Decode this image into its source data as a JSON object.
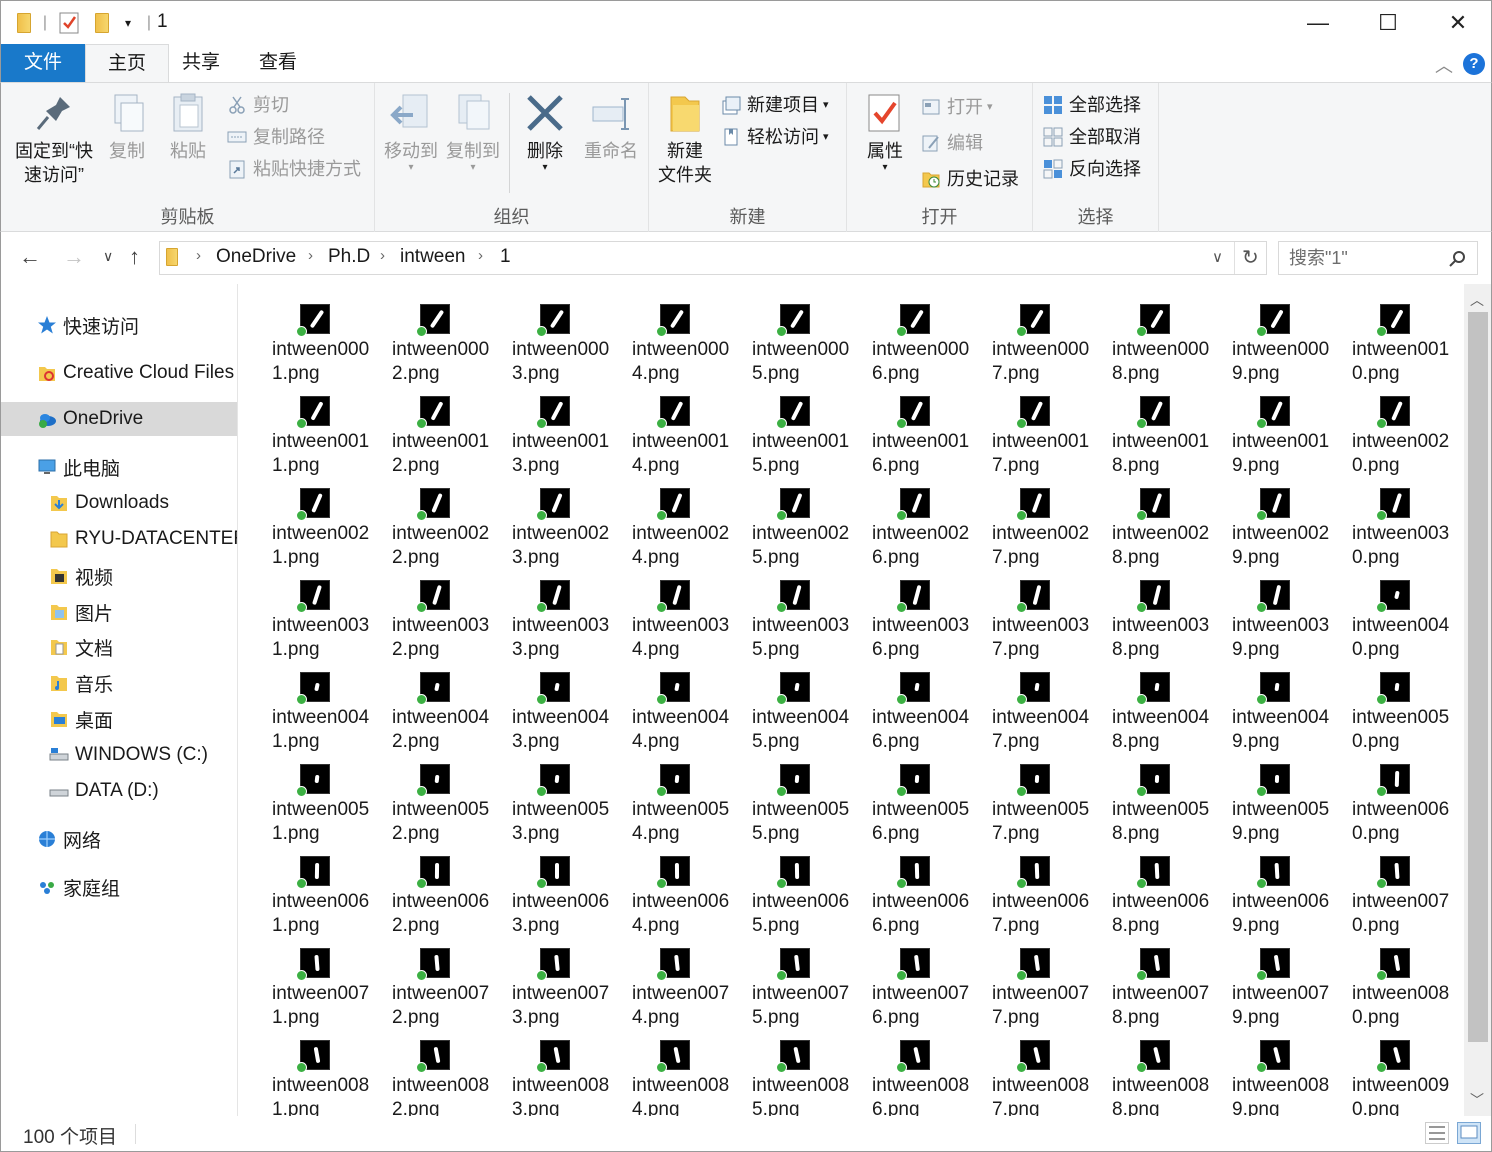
{
  "window": {
    "title": "1",
    "minimize_glyph": "—",
    "maximize_glyph": "☐",
    "close_glyph": "✕"
  },
  "ribbon_tabs": {
    "file": "文件",
    "home": "主页",
    "share": "共享",
    "view": "查看"
  },
  "ribbon": {
    "clipboard": {
      "label": "剪贴板",
      "pin_line1": "固定到“快",
      "pin_line2": "速访问”",
      "copy": "复制",
      "paste": "粘贴",
      "cut": "剪切",
      "copy_path": "复制路径",
      "paste_shortcut": "粘贴快捷方式"
    },
    "organize": {
      "label": "组织",
      "move_to": "移动到",
      "copy_to": "复制到",
      "delete": "删除",
      "rename": "重命名"
    },
    "new": {
      "label": "新建",
      "new_folder_line1": "新建",
      "new_folder_line2": "文件夹",
      "new_item": "新建项目",
      "easy_access": "轻松访问"
    },
    "open": {
      "label": "打开",
      "properties": "属性",
      "open": "打开",
      "edit": "编辑",
      "history": "历史记录"
    },
    "select": {
      "label": "选择",
      "select_all": "全部选择",
      "select_none": "全部取消",
      "invert": "反向选择"
    }
  },
  "address": {
    "breadcrumb": [
      "OneDrive",
      "Ph.D",
      "intween",
      "1"
    ],
    "search_placeholder": "搜索\"1\""
  },
  "nav_pane": {
    "items": [
      {
        "label": "快速访问",
        "icon": "star-icon"
      },
      {
        "label": "Creative Cloud Files",
        "icon": "creative-cloud-icon"
      },
      {
        "label": "OneDrive",
        "icon": "onedrive-icon",
        "selected": true
      },
      {
        "label": "此电脑",
        "icon": "computer-icon"
      },
      {
        "label": "Downloads",
        "icon": "downloads-folder-icon"
      },
      {
        "label": "RYU-DATACENTEF",
        "icon": "folder-icon"
      },
      {
        "label": "视频",
        "icon": "videos-folder-icon"
      },
      {
        "label": "图片",
        "icon": "pictures-folder-icon"
      },
      {
        "label": "文档",
        "icon": "documents-folder-icon"
      },
      {
        "label": "音乐",
        "icon": "music-folder-icon"
      },
      {
        "label": "桌面",
        "icon": "desktop-folder-icon"
      },
      {
        "label": "WINDOWS (C:)",
        "icon": "drive-c-icon"
      },
      {
        "label": "DATA (D:)",
        "icon": "drive-d-icon"
      },
      {
        "label": "网络",
        "icon": "network-icon"
      },
      {
        "label": "家庭组",
        "icon": "homegroup-icon"
      }
    ]
  },
  "files": {
    "prefix": "intween00",
    "extension": ".png",
    "visible_count": 90,
    "sync_status": "synced"
  },
  "status": {
    "count_text": "100 个项目"
  }
}
